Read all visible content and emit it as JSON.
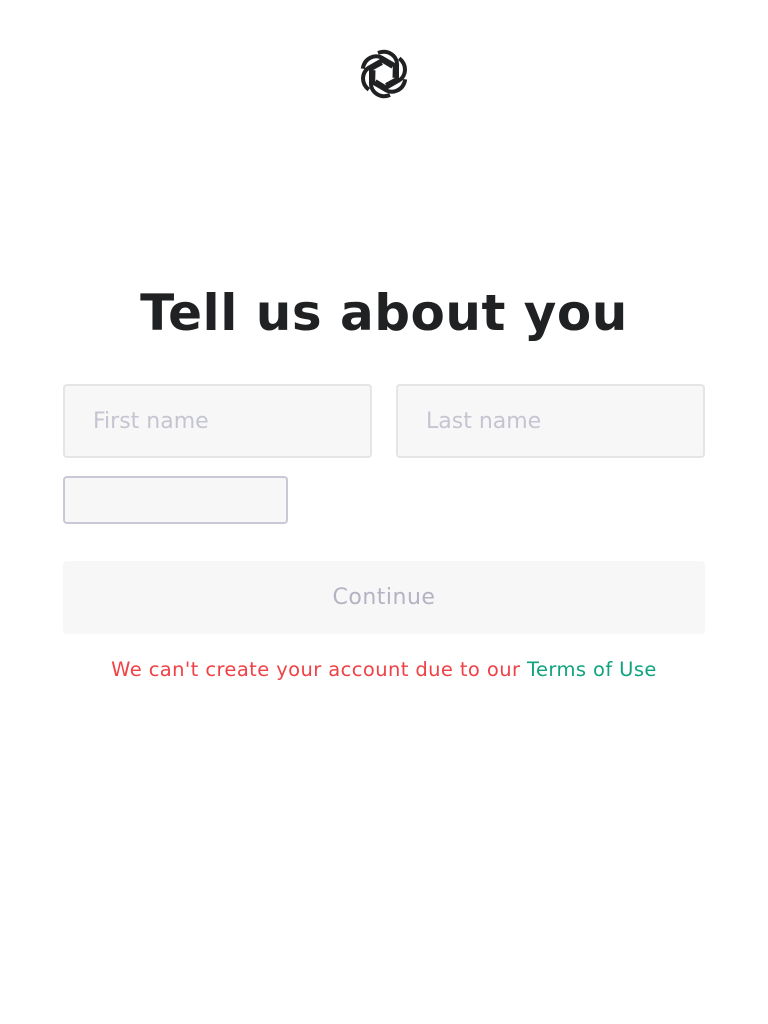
{
  "colors": {
    "heading": "#202123",
    "error": "#ef4146",
    "link": "#10a37f",
    "field_background": "#f7f7f8",
    "placeholder": "#c5c5d2",
    "button_text_disabled": "#b4b3c4"
  },
  "logo": {
    "icon": "openai-logo-icon"
  },
  "heading": "Tell us about you",
  "form": {
    "first_name_placeholder": "First name",
    "last_name_placeholder": "Last name",
    "birthday_value": "",
    "continue_label": "Continue"
  },
  "error": {
    "message": "We can't create your account due to our ",
    "link_label": "Terms of Use"
  }
}
